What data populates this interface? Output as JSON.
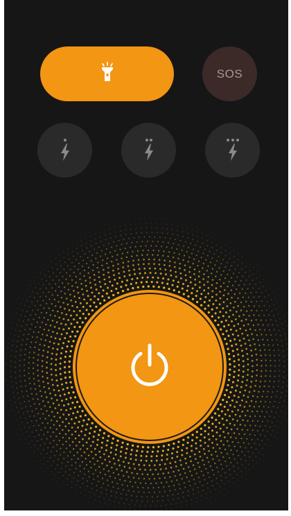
{
  "app": {
    "accent_color": "#f29613",
    "background_color": "#161616"
  },
  "mode_toggle": {
    "icon": "flashlight-icon",
    "state": "active"
  },
  "sos": {
    "label": "SOS"
  },
  "strobe_modes": [
    {
      "icon": "strobe-slow-icon",
      "dots": 1
    },
    {
      "icon": "strobe-medium-icon",
      "dots": 2
    },
    {
      "icon": "strobe-fast-icon",
      "dots": 3
    }
  ],
  "power": {
    "icon": "power-icon",
    "state": "on"
  }
}
